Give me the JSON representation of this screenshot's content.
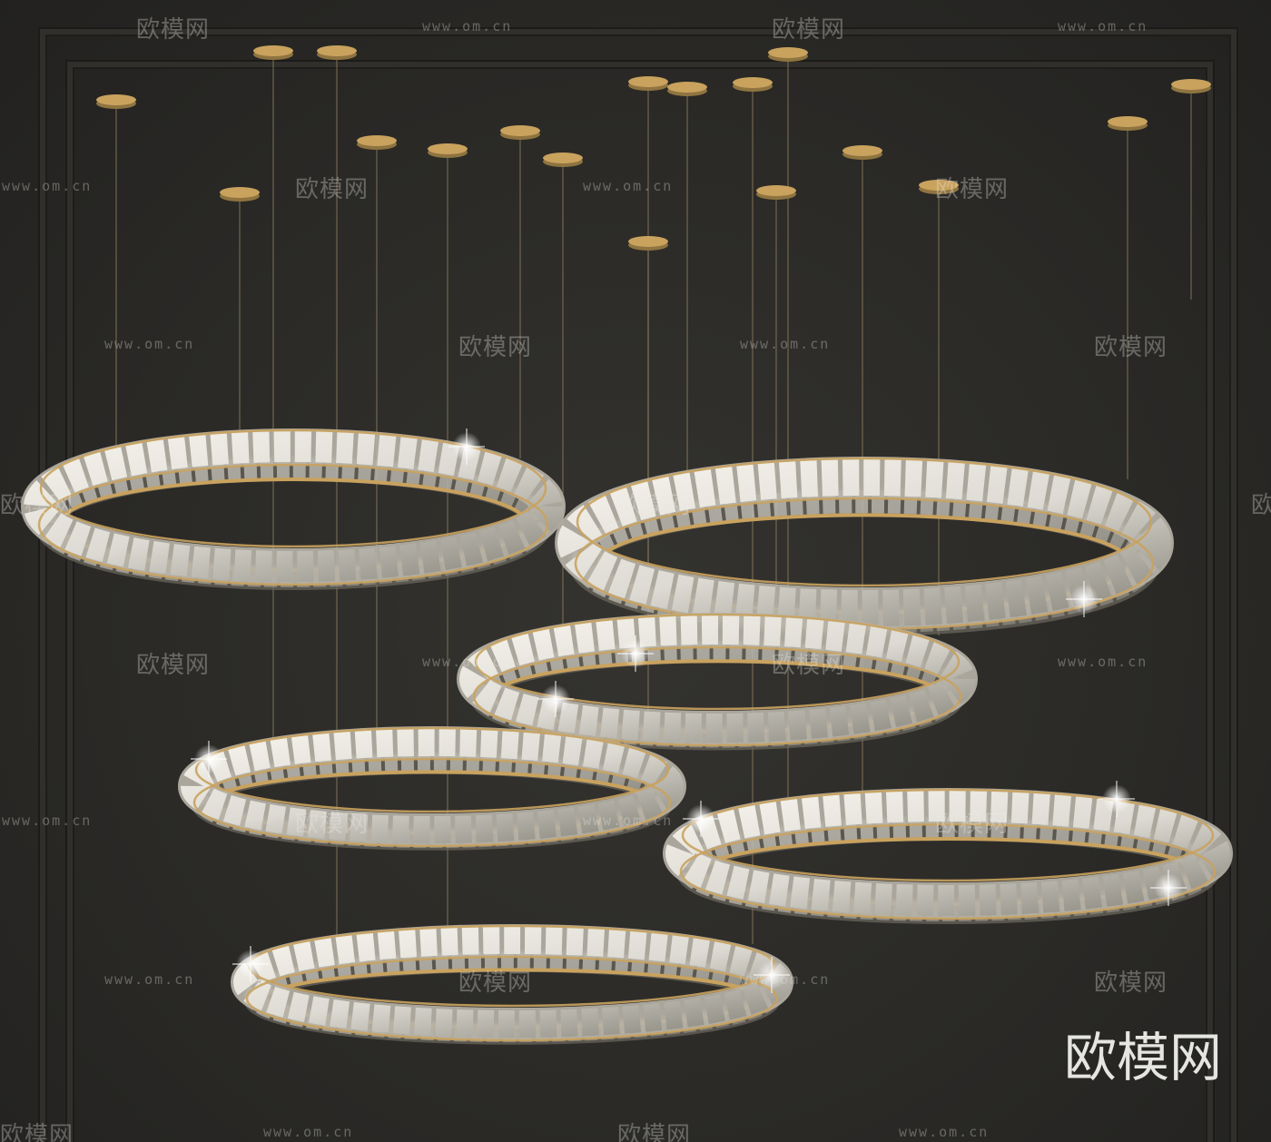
{
  "watermark": {
    "url_text": "www.om.cn",
    "brand_text": "欧模网",
    "corner_brand_text": "欧模网"
  },
  "scene": {
    "subject": "crystal ring chandeliers",
    "background_color": "#2b2a27",
    "metal_color": "#c9a25e",
    "crystal_color": "#dcdad2"
  }
}
